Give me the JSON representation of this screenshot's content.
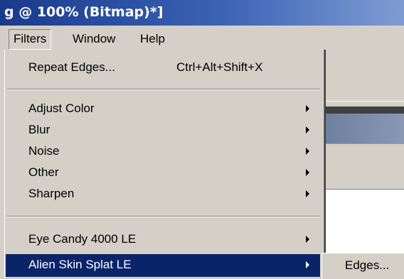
{
  "window": {
    "title": "g @ 100% (Bitmap)*]"
  },
  "menubar": {
    "items": [
      {
        "label": "Filters",
        "active": true
      },
      {
        "label": "Window",
        "active": false
      },
      {
        "label": "Help",
        "active": false
      }
    ]
  },
  "filters_menu": {
    "repeat": {
      "label": "Repeat Edges...",
      "shortcut": "Ctrl+Alt+Shift+X"
    },
    "items": [
      {
        "label": "Adjust Color",
        "has_submenu": true
      },
      {
        "label": "Blur",
        "has_submenu": true
      },
      {
        "label": "Noise",
        "has_submenu": true
      },
      {
        "label": "Other",
        "has_submenu": true
      },
      {
        "label": "Sharpen",
        "has_submenu": true
      }
    ],
    "plugins": [
      {
        "label": "Eye Candy 4000 LE",
        "has_submenu": true
      },
      {
        "label": "Alien Skin Splat LE",
        "has_submenu": true,
        "highlighted": true
      }
    ]
  },
  "submenu": {
    "items": [
      {
        "label": "Edges..."
      }
    ]
  },
  "colors": {
    "highlight": "#0a246a",
    "menu_bg": "#d4d0c8",
    "title_gradient_start": "#1a3a8c"
  }
}
